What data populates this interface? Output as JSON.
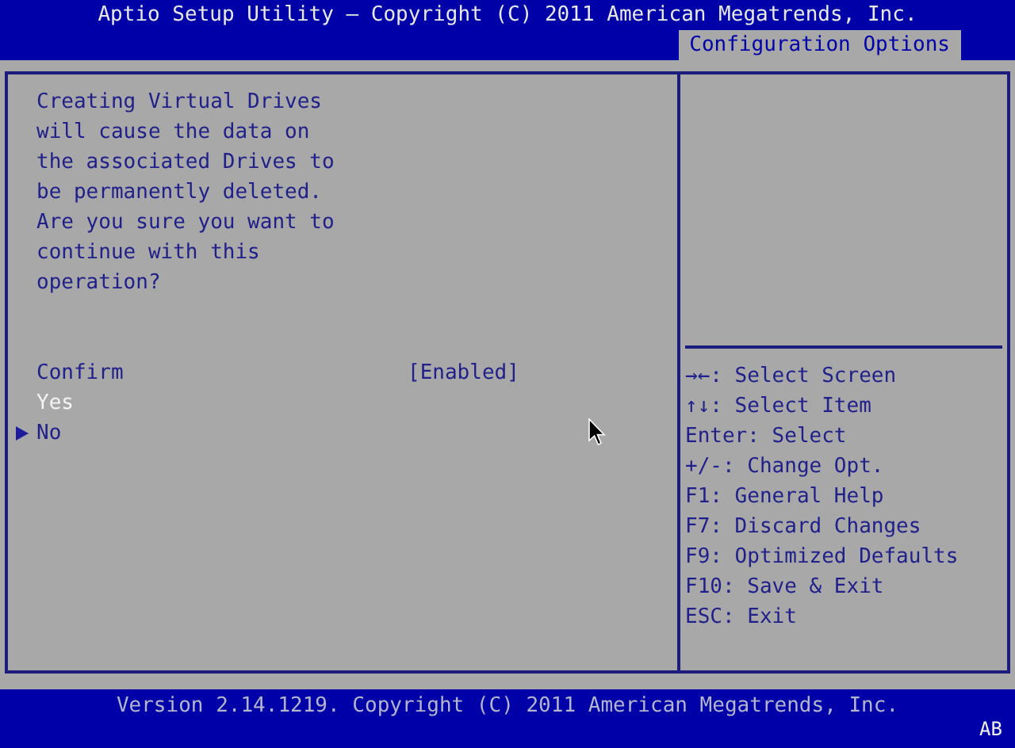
{
  "header": {
    "title": "Aptio Setup Utility – Copyright (C) 2011 American Megatrends, Inc.",
    "tabs": [
      {
        "label": "Configuration Options",
        "selected": true
      }
    ]
  },
  "main": {
    "message": [
      "Creating Virtual Drives",
      "will cause the data on",
      "the associated Drives to",
      "be permanently deleted.",
      "Are you sure you want to",
      "continue with this",
      "operation?"
    ],
    "items": [
      {
        "kind": "setting",
        "label": "Confirm",
        "value": "[Enabled]",
        "selected": false
      },
      {
        "kind": "action",
        "label": "Yes",
        "selected": true
      },
      {
        "kind": "submenu",
        "label": "No",
        "selected": false
      }
    ]
  },
  "help": [
    "→←: Select Screen",
    "↑↓: Select Item",
    "Enter: Select",
    "+/-: Change Opt.",
    "F1: General Help",
    "F7: Discard Changes",
    "F9: Optimized Defaults",
    "F10: Save & Exit",
    "ESC: Exit"
  ],
  "footer": {
    "version": "Version 2.14.1219. Copyright (C) 2011 American Megatrends, Inc.",
    "corner": "AB"
  }
}
